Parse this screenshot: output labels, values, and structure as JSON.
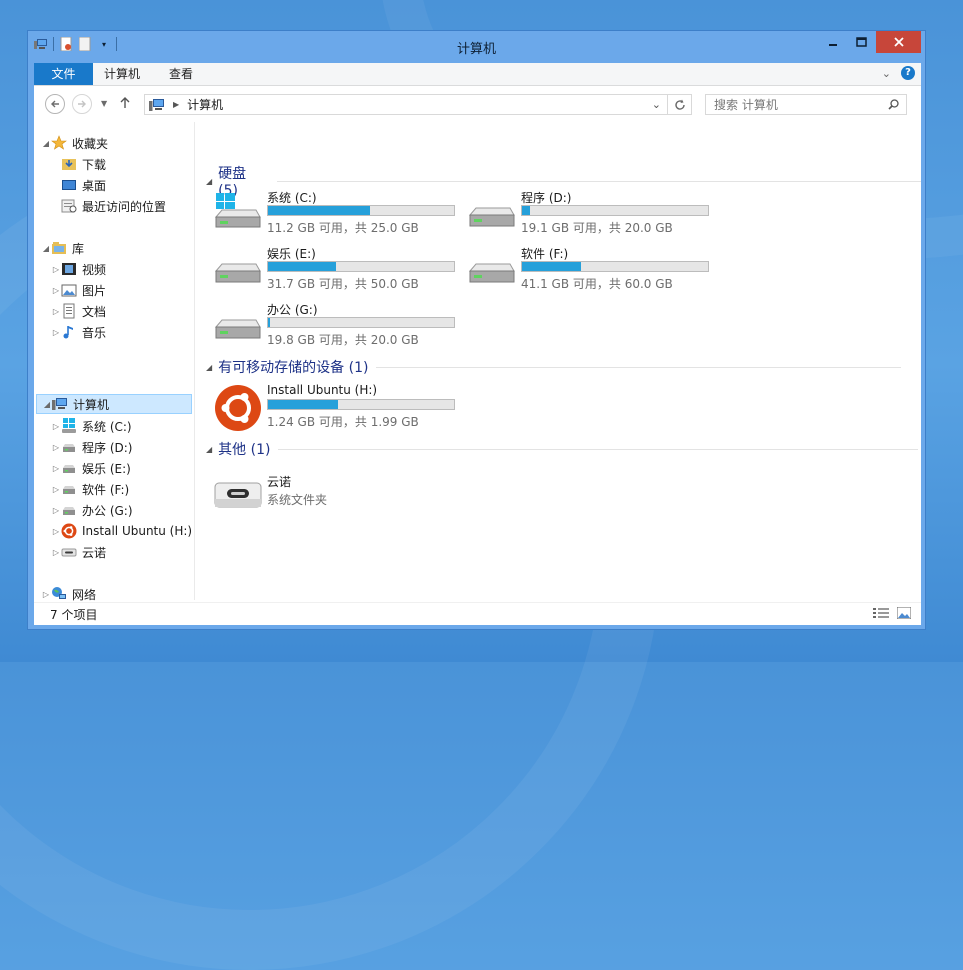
{
  "window": {
    "title": "计算机"
  },
  "ribbon": {
    "file_tab": "文件",
    "tabs": [
      "计算机",
      "查看"
    ],
    "help_label": "?"
  },
  "address": {
    "path": "计算机",
    "search_placeholder": "搜索 计算机"
  },
  "nav": {
    "favorites": {
      "label": "收藏夹",
      "items": [
        "下载",
        "桌面",
        "最近访问的位置"
      ]
    },
    "libraries": {
      "label": "库",
      "items": [
        "视频",
        "图片",
        "文档",
        "音乐"
      ]
    },
    "computer": {
      "label": "计算机",
      "items": [
        "系统 (C:)",
        "程序 (D:)",
        "娱乐 (E:)",
        "软件 (F:)",
        "办公 (G:)",
        "Install Ubuntu (H:)",
        "云诺"
      ]
    },
    "network": {
      "label": "网络"
    }
  },
  "groups": {
    "hdd": {
      "title": "硬盘 (5)",
      "drives": [
        {
          "name": "系统 (C:)",
          "info": "11.2 GB 可用，共 25.0 GB",
          "used_fraction": 0.55
        },
        {
          "name": "程序 (D:)",
          "info": "19.1 GB 可用，共 20.0 GB",
          "used_fraction": 0.045
        },
        {
          "name": "娱乐 (E:)",
          "info": "31.7 GB 可用，共 50.0 GB",
          "used_fraction": 0.366
        },
        {
          "name": "软件 (F:)",
          "info": "41.1 GB 可用，共 60.0 GB",
          "used_fraction": 0.315
        },
        {
          "name": "办公 (G:)",
          "info": "19.8 GB 可用，共 20.0 GB",
          "used_fraction": 0.01
        }
      ]
    },
    "removable": {
      "title": "有可移动存储的设备 (1)",
      "drives": [
        {
          "name": "Install Ubuntu (H:)",
          "info": "1.24 GB 可用，共 1.99 GB",
          "used_fraction": 0.377
        }
      ]
    },
    "other": {
      "title": "其他 (1)",
      "items": [
        {
          "name": "云诺",
          "sub": "系统文件夹"
        }
      ]
    }
  },
  "status": {
    "count": "7 个项目"
  },
  "colors": {
    "accent": "#1979ca",
    "bar_fill": "#26a0da",
    "group_title": "#1e3287",
    "close": "#c7463a"
  }
}
